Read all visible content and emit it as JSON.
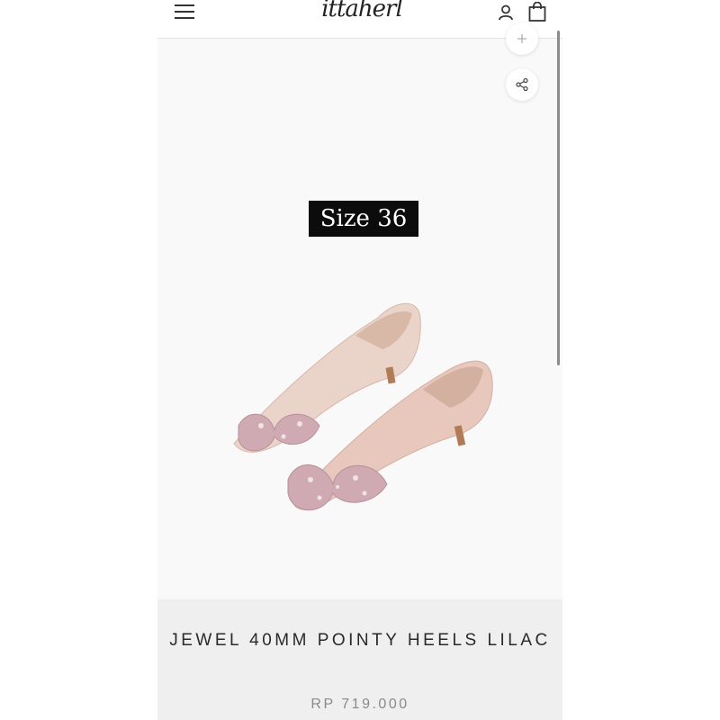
{
  "header": {
    "brand": "ittaherl",
    "menu_icon": "hamburger-menu-icon",
    "account_icon": "user-icon",
    "cart_icon": "shopping-bag-icon"
  },
  "product": {
    "overlay_label": "Size 36",
    "image_icon": "pink-sequin-bow-heels-photo",
    "zoom_icon": "zoom-icon",
    "share_icon": "share-icon",
    "title": "JEWEL 40MM POINTY HEELS LILAC",
    "price": "RP 719.000"
  },
  "colors": {
    "overlay_bg": "#0c0c0c",
    "info_bg": "#efefef",
    "price_text": "#8a8a8a",
    "shoe": "#e8c8c0",
    "bow": "#c9a6ae"
  }
}
